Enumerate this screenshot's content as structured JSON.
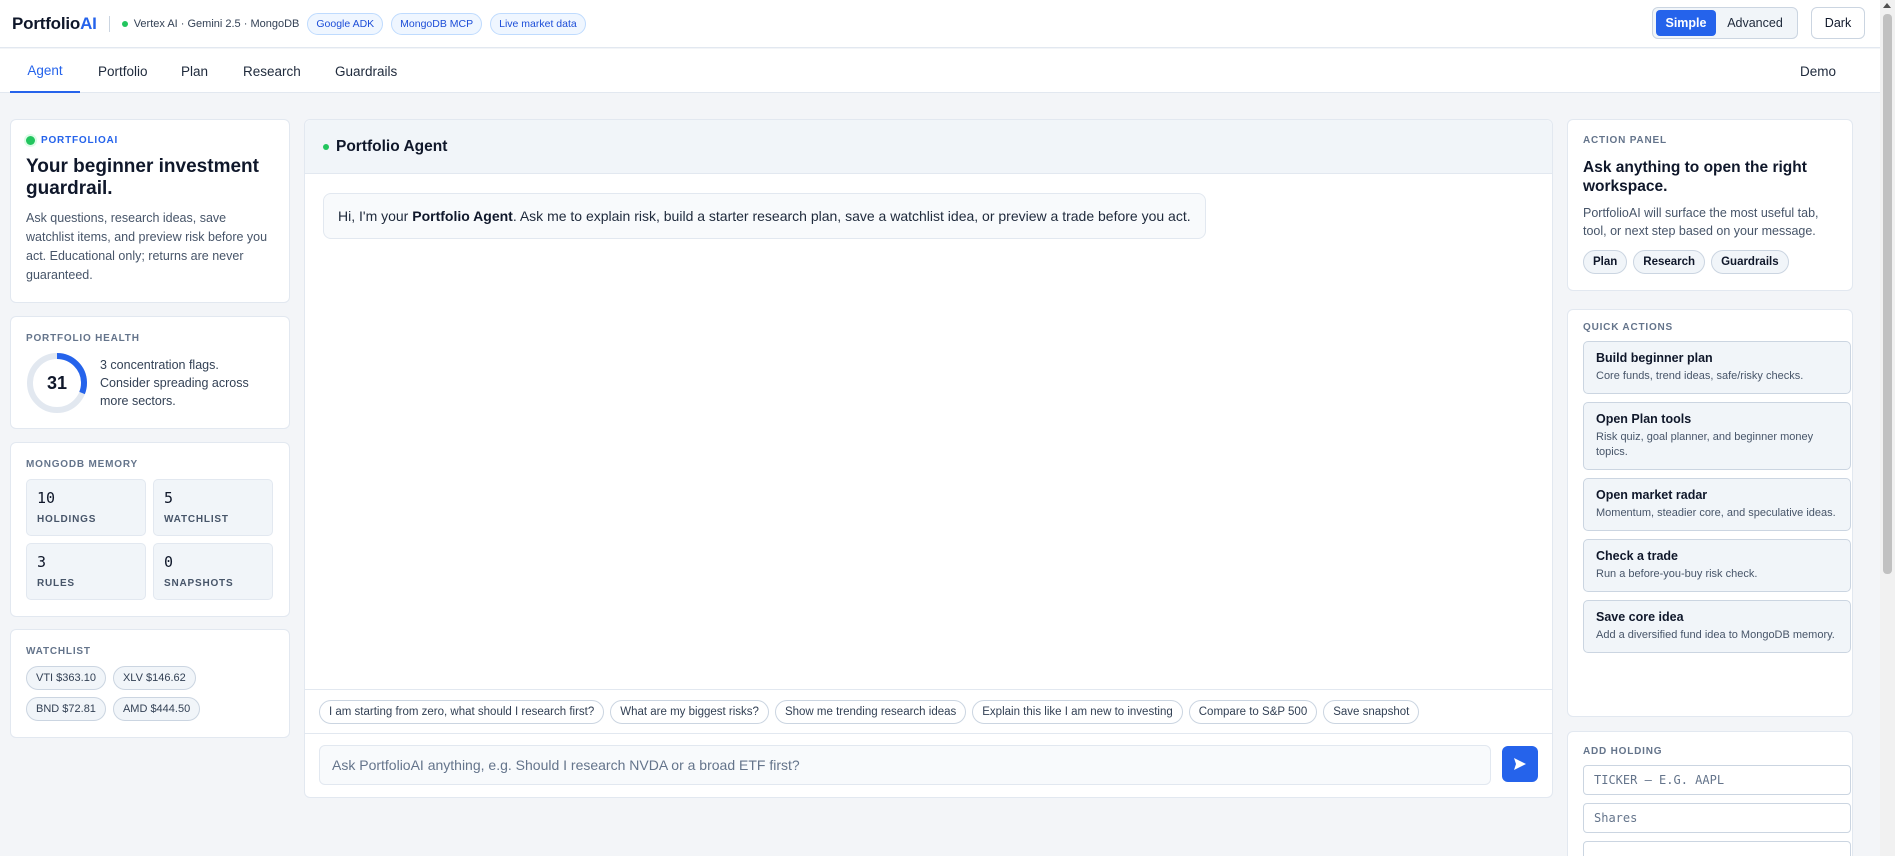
{
  "header": {
    "logo_main": "Portfolio",
    "logo_accent": "AI",
    "stack_label": "Vertex AI · Gemini 2.5 · MongoDB",
    "tags": [
      "Google ADK",
      "MongoDB MCP",
      "Live market data"
    ],
    "mode_simple": "Simple",
    "mode_advanced": "Advanced",
    "theme_label": "Dark"
  },
  "nav": {
    "tabs": [
      "Agent",
      "Portfolio",
      "Plan",
      "Research",
      "Guardrails"
    ],
    "active_tab": "Agent",
    "demo_label": "Demo"
  },
  "left": {
    "brand": "PORTFOLIOAI",
    "title": "Your beginner investment guardrail.",
    "description": "Ask questions, research ideas, save watchlist items, and preview risk before you act. Educational only; returns are never guaranteed.",
    "health": {
      "label": "PORTFOLIO HEALTH",
      "score": "31",
      "score_fraction": 0.31,
      "text": "3 concentration flags. Consider spreading across more sectors."
    },
    "memory": {
      "label": "MONGODB MEMORY",
      "stats": [
        {
          "value": "10",
          "label": "HOLDINGS"
        },
        {
          "value": "5",
          "label": "WATCHLIST"
        },
        {
          "value": "3",
          "label": "RULES"
        },
        {
          "value": "0",
          "label": "SNAPSHOTS"
        }
      ]
    },
    "watchlist": {
      "label": "WATCHLIST",
      "items": [
        "VTI $363.10",
        "XLV $146.62",
        "BND $72.81",
        "AMD $444.50"
      ]
    }
  },
  "center": {
    "title": "Portfolio Agent",
    "greeting_prefix": "Hi, I'm your ",
    "greeting_bold": "Portfolio Agent",
    "greeting_suffix": ". Ask me to explain risk, build a starter research plan, save a watchlist idea, or preview a trade before you act.",
    "suggestions": [
      "I am starting from zero, what should I research first?",
      "What are my biggest risks?",
      "Show me trending research ideas",
      "Explain this like I am new to investing",
      "Compare to S&P 500",
      "Save snapshot"
    ],
    "input_placeholder": "Ask PortfolioAI anything, e.g. Should I research NVDA or a broad ETF first?"
  },
  "right": {
    "action_panel": {
      "label": "ACTION PANEL",
      "title": "Ask anything to open the right workspace.",
      "text": "PortfolioAI will surface the most useful tab, tool, or next step based on your message.",
      "chips": [
        "Plan",
        "Research",
        "Guardrails"
      ]
    },
    "quick_actions": {
      "label": "QUICK ACTIONS",
      "items": [
        {
          "title": "Build beginner plan",
          "desc": "Core funds, trend ideas, safe/risky checks."
        },
        {
          "title": "Open Plan tools",
          "desc": "Risk quiz, goal planner, and beginner money topics."
        },
        {
          "title": "Open market radar",
          "desc": "Momentum, steadier core, and speculative ideas."
        },
        {
          "title": "Check a trade",
          "desc": "Run a before-you-buy risk check."
        },
        {
          "title": "Save core idea",
          "desc": "Add a diversified fund idea to MongoDB memory."
        }
      ]
    },
    "add_holding": {
      "label": "ADD HOLDING",
      "ticker_placeholder": "TICKER — E.G. AAPL",
      "shares_placeholder": "Shares"
    }
  },
  "colors": {
    "accent": "#2563eb",
    "status_green": "#22c55e"
  }
}
